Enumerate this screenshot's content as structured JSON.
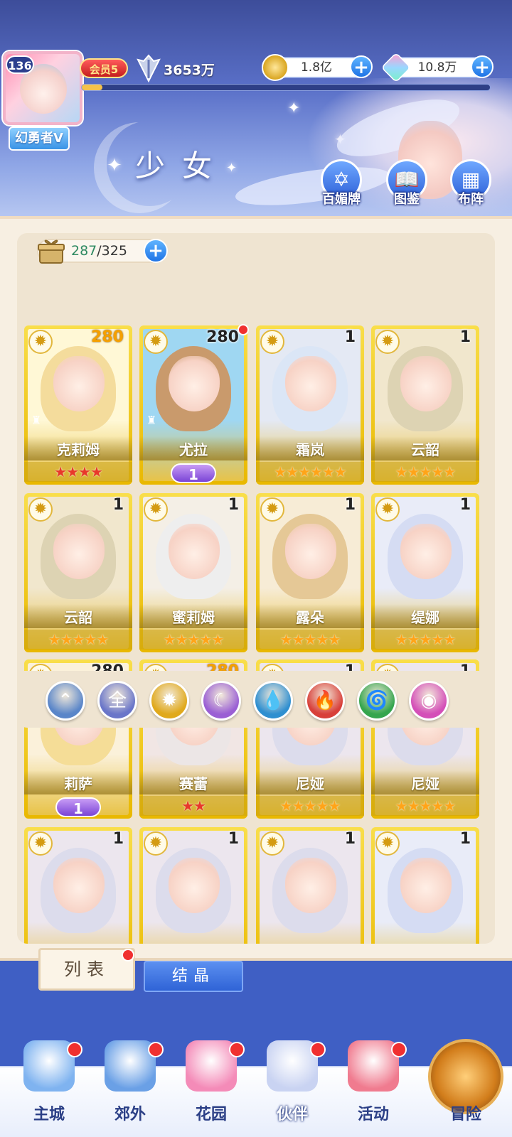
{
  "header": {
    "level": "136",
    "username": "幻勇者V",
    "vip_label": "会员5",
    "power": "3653万",
    "exp_fraction": 0.05,
    "gold": "1.8亿",
    "diamonds": "10.8万",
    "title": "少女",
    "buttons": [
      {
        "label": "百媚牌",
        "icon": "card-deck-icon"
      },
      {
        "label": "图鉴",
        "icon": "book-icon"
      },
      {
        "label": "布阵",
        "icon": "formation-grid-icon"
      }
    ]
  },
  "capacity": {
    "current": "287",
    "max": "/325"
  },
  "cards": [
    {
      "name": "克莉姆",
      "level": "280",
      "level_style": "gold",
      "stars": 4,
      "star_color": "red",
      "lock": true,
      "wing": "",
      "dot": false,
      "hair": "#f4dc9c",
      "bg": "#fff8d6"
    },
    {
      "name": "尤拉",
      "level": "280",
      "level_style": "normal",
      "stars": 0,
      "star_color": "",
      "lock": true,
      "wing": "1",
      "dot": true,
      "hair": "#c99a6c",
      "bg": "#9fd7f2"
    },
    {
      "name": "霜岚",
      "level": "1",
      "level_style": "normal",
      "stars": 6,
      "star_color": "orange",
      "lock": false,
      "wing": "",
      "dot": false,
      "hair": "#dbe6f6",
      "bg": "#e4e9f4"
    },
    {
      "name": "云韶",
      "level": "1",
      "level_style": "normal",
      "stars": 5,
      "star_color": "orange",
      "lock": false,
      "wing": "",
      "dot": false,
      "hair": "#ddd3b3",
      "bg": "#f1e7cd"
    },
    {
      "name": "云韶",
      "level": "1",
      "level_style": "normal",
      "stars": 5,
      "star_color": "orange",
      "lock": false,
      "wing": "",
      "dot": false,
      "hair": "#ddd3b3",
      "bg": "#f1e7cd"
    },
    {
      "name": "蜜莉姆",
      "level": "1",
      "level_style": "normal",
      "stars": 5,
      "star_color": "orange",
      "lock": false,
      "wing": "",
      "dot": false,
      "hair": "#eeeeee",
      "bg": "#f4efe6"
    },
    {
      "name": "露朵",
      "level": "1",
      "level_style": "normal",
      "stars": 5,
      "star_color": "orange",
      "lock": false,
      "wing": "",
      "dot": false,
      "hair": "#e5c896",
      "bg": "#f7ecd6"
    },
    {
      "name": "缇娜",
      "level": "1",
      "level_style": "normal",
      "stars": 5,
      "star_color": "orange",
      "lock": false,
      "wing": "",
      "dot": false,
      "hair": "#d5dcf3",
      "bg": "#e9ecf8"
    },
    {
      "name": "莉萨",
      "level": "280",
      "level_style": "normal",
      "stars": 0,
      "star_color": "",
      "lock": false,
      "wing": "1",
      "dot": false,
      "hair": "#f5dd97",
      "bg": "#fbf1da"
    },
    {
      "name": "赛蕾",
      "level": "280",
      "level_style": "gold",
      "stars": 2,
      "star_color": "red",
      "lock": false,
      "wing": "",
      "dot": false,
      "hair": "#ece6e6",
      "bg": "#f1e6e4"
    },
    {
      "name": "尼娅",
      "level": "1",
      "level_style": "normal",
      "stars": 5,
      "star_color": "orange",
      "lock": false,
      "wing": "",
      "dot": false,
      "hair": "#dcdcec",
      "bg": "#ece6ee"
    },
    {
      "name": "尼娅",
      "level": "1",
      "level_style": "normal",
      "stars": 5,
      "star_color": "orange",
      "lock": false,
      "wing": "",
      "dot": false,
      "hair": "#dcdcec",
      "bg": "#ece6ee"
    },
    {
      "name": "",
      "level": "1",
      "level_style": "normal",
      "stars": 0,
      "star_color": "",
      "lock": false,
      "wing": "",
      "dot": false,
      "hair": "#dcdcec",
      "bg": "#ece6ee"
    },
    {
      "name": "",
      "level": "1",
      "level_style": "normal",
      "stars": 0,
      "star_color": "",
      "lock": false,
      "wing": "",
      "dot": false,
      "hair": "#dcdcec",
      "bg": "#ece6ee"
    },
    {
      "name": "",
      "level": "1",
      "level_style": "normal",
      "stars": 0,
      "star_color": "",
      "lock": false,
      "wing": "",
      "dot": false,
      "hair": "#dcdcec",
      "bg": "#ece6ee"
    },
    {
      "name": "",
      "level": "1",
      "level_style": "normal",
      "stars": 0,
      "star_color": "",
      "lock": false,
      "wing": "",
      "dot": false,
      "hair": "#d5dcf3",
      "bg": "#e9ecf8"
    }
  ],
  "filters": [
    {
      "name": "filter-top-tier",
      "glyph": "⌃",
      "color": "#5a86c9"
    },
    {
      "name": "filter-all",
      "glyph": "全",
      "color": "#6a76c9"
    },
    {
      "name": "filter-sun",
      "glyph": "✹",
      "color": "#e0a91c"
    },
    {
      "name": "filter-moon",
      "glyph": "☾",
      "color": "#9a5fd4"
    },
    {
      "name": "filter-water",
      "glyph": "💧",
      "color": "#2f8fd0"
    },
    {
      "name": "filter-fire",
      "glyph": "🔥",
      "color": "#d8403a"
    },
    {
      "name": "filter-wind",
      "glyph": "🌀",
      "color": "#35a54e"
    },
    {
      "name": "filter-heart",
      "glyph": "◉",
      "color": "#d44fb8"
    }
  ],
  "tabs": {
    "list": "列表",
    "crystal": "结晶"
  },
  "nav": [
    {
      "label": "主城",
      "icon": "castle-icon",
      "color": "#7fb3f0",
      "dot": true
    },
    {
      "label": "郊外",
      "icon": "gate-icon",
      "color": "#6aa0e6",
      "dot": true
    },
    {
      "label": "花园",
      "icon": "heart-garden-icon",
      "color": "#f48bb8",
      "dot": true
    },
    {
      "label": "伙伴",
      "icon": "partner-portrait-icon",
      "color": "#c9d3f2",
      "dot": true
    },
    {
      "label": "活动",
      "icon": "gift-icon",
      "color": "#f07b8f",
      "dot": true
    }
  ],
  "adventure": {
    "label": "冒险"
  }
}
